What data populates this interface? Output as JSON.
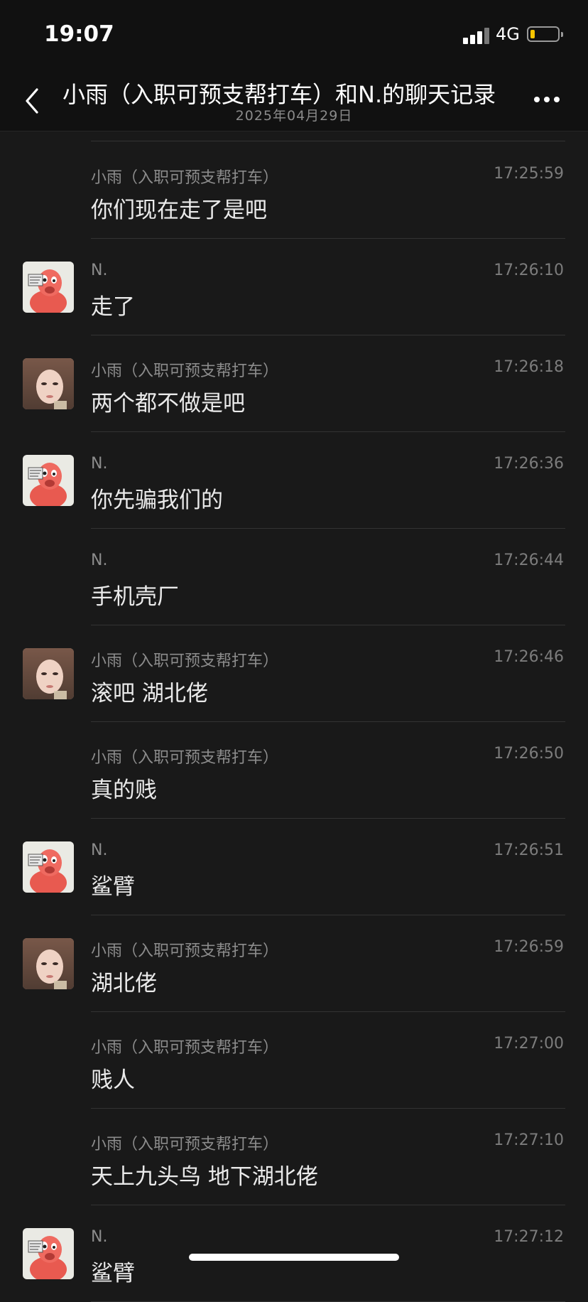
{
  "status_bar": {
    "time": "19:07",
    "network": "4G",
    "battery_color": "#f5c400"
  },
  "header": {
    "back_icon": "chevron-left-icon",
    "title": "小雨（入职可预支帮打车）和N.的聊天记录",
    "subtitle": "2025年04月29日",
    "more_icon": "ellipsis-icon"
  },
  "messages": [
    {
      "sender": "小雨（入职可预支帮打车）",
      "time": "17:25:59",
      "text": "你们现在走了是吧",
      "avatar": "none"
    },
    {
      "sender": "N.",
      "time": "17:26:10",
      "text": "走了",
      "avatar": "n-avatar"
    },
    {
      "sender": "小雨（入职可预支帮打车）",
      "time": "17:26:18",
      "text": "两个都不做是吧",
      "avatar": "xiaoyu-avatar"
    },
    {
      "sender": "N.",
      "time": "17:26:36",
      "text": "你先骗我们的",
      "avatar": "n-avatar"
    },
    {
      "sender": "N.",
      "time": "17:26:44",
      "text": "手机壳厂",
      "avatar": "none"
    },
    {
      "sender": "小雨（入职可预支帮打车）",
      "time": "17:26:46",
      "text": "滚吧 湖北佬",
      "avatar": "xiaoyu-avatar"
    },
    {
      "sender": "小雨（入职可预支帮打车）",
      "time": "17:26:50",
      "text": "真的贱",
      "avatar": "none"
    },
    {
      "sender": "N.",
      "time": "17:26:51",
      "text": "鲨臂",
      "avatar": "n-avatar"
    },
    {
      "sender": "小雨（入职可预支帮打车）",
      "time": "17:26:59",
      "text": "湖北佬",
      "avatar": "xiaoyu-avatar"
    },
    {
      "sender": "小雨（入职可预支帮打车）",
      "time": "17:27:00",
      "text": "贱人",
      "avatar": "none"
    },
    {
      "sender": "小雨（入职可预支帮打车）",
      "time": "17:27:10",
      "text": "天上九头鸟 地下湖北佬",
      "avatar": "none"
    },
    {
      "sender": "N.",
      "time": "17:27:12",
      "text": "鲨臂",
      "avatar": "n-avatar"
    }
  ]
}
